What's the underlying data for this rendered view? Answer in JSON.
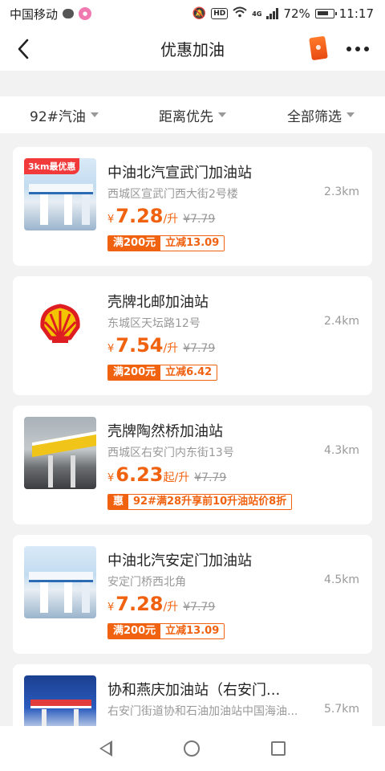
{
  "status_bar": {
    "carrier": "中国移动",
    "battery": "72%",
    "time": "11:17",
    "hd_label": "HD",
    "net_label": "4G"
  },
  "header": {
    "title": "优惠加油",
    "icons": [
      "back-arrow-icon",
      "wallet-icon",
      "more-icon"
    ]
  },
  "filters": [
    {
      "label": "92#汽油"
    },
    {
      "label": "距离优先"
    },
    {
      "label": "全部筛选"
    }
  ],
  "stations": [
    {
      "name": "中油北汽宣武门加油站",
      "address": "西城区宣武门西大街2号楼",
      "distance": "2.3km",
      "currency": "¥",
      "price": "7.28",
      "unit": "/升",
      "original_price": "¥7.79",
      "promo_tag": "3km最优惠",
      "deal_key": "满200元",
      "deal_value": "立减13.09",
      "thumb": "station-photo"
    },
    {
      "name": "壳牌北邮加油站",
      "address": "东城区天坛路12号",
      "distance": "2.4km",
      "currency": "¥",
      "price": "7.54",
      "unit": "/升",
      "original_price": "¥7.79",
      "deal_key": "满200元",
      "deal_value": "立减6.42",
      "thumb": "shell-logo"
    },
    {
      "name": "壳牌陶然桥加油站",
      "address": "西城区右安门内东街13号",
      "distance": "4.3km",
      "currency": "¥",
      "price": "6.23",
      "unit": "起/升",
      "original_price": "¥7.79",
      "deal_key": "惠",
      "deal_value": "92#满28升享前10升油站价8折",
      "thumb": "canopy-photo"
    },
    {
      "name": "中油北汽安定门加油站",
      "address": "安定门桥西北角",
      "distance": "4.5km",
      "currency": "¥",
      "price": "7.28",
      "unit": "/升",
      "original_price": "¥7.79",
      "deal_key": "满200元",
      "deal_value": "立减13.09",
      "thumb": "station-photo"
    },
    {
      "name": "协和燕庆加油站（右安门...",
      "address": "右安门街道协和石油加油站中国海油...",
      "distance": "5.7km",
      "thumb": "petro-photo"
    }
  ],
  "colors": {
    "accent": "#f0620f",
    "promo_red": "#f23a3a",
    "muted": "#999999"
  }
}
